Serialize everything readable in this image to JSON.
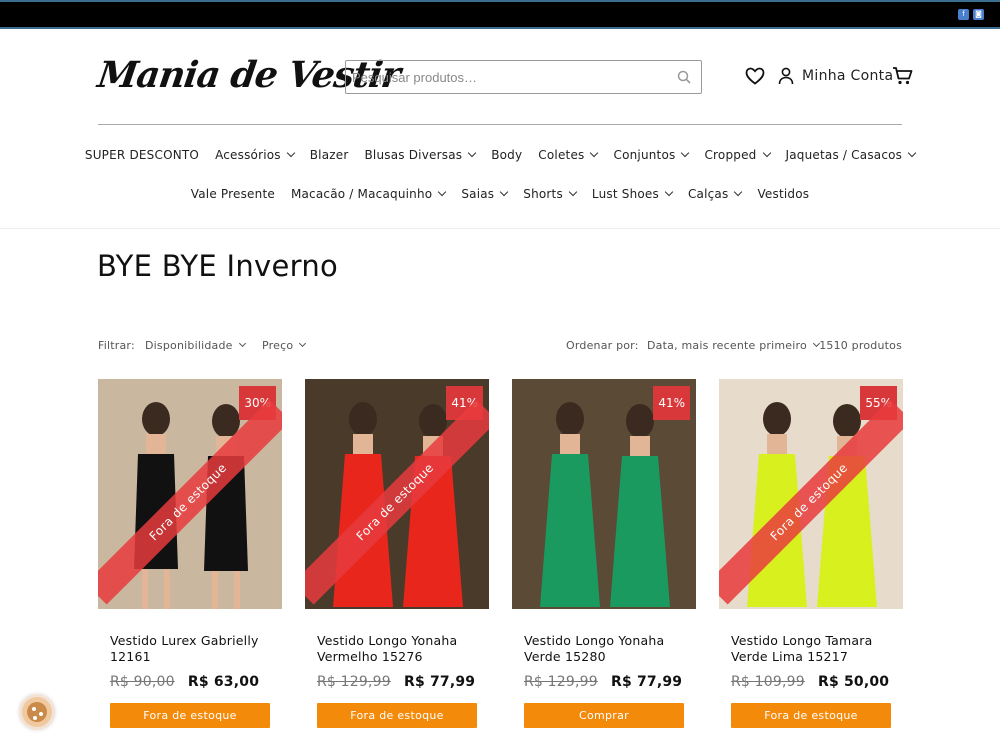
{
  "logo": "Mania de Vestir",
  "search": {
    "placeholder": "Pesquisar produtos…"
  },
  "header": {
    "account_label": "Minha Conta"
  },
  "nav_row1": [
    {
      "label": "SUPER DESCONTO",
      "dropdown": false
    },
    {
      "label": "Acessórios",
      "dropdown": true
    },
    {
      "label": "Blazer",
      "dropdown": false
    },
    {
      "label": "Blusas Diversas",
      "dropdown": true
    },
    {
      "label": "Body",
      "dropdown": false
    },
    {
      "label": "Coletes",
      "dropdown": true
    },
    {
      "label": "Conjuntos",
      "dropdown": true
    },
    {
      "label": "Cropped",
      "dropdown": true
    },
    {
      "label": "Jaquetas / Casacos",
      "dropdown": true
    }
  ],
  "nav_row2": [
    {
      "label": "Vale Presente",
      "dropdown": false
    },
    {
      "label": "Macacão / Macaquinho",
      "dropdown": true
    },
    {
      "label": "Saias",
      "dropdown": true
    },
    {
      "label": "Shorts",
      "dropdown": true
    },
    {
      "label": "Lust Shoes",
      "dropdown": true
    },
    {
      "label": "Calças",
      "dropdown": true
    },
    {
      "label": "Vestidos",
      "dropdown": false
    }
  ],
  "collection": {
    "title": "BYE BYE Inverno"
  },
  "filters": {
    "filter_label": "Filtrar:",
    "availability": "Disponibilidade",
    "price": "Preço",
    "sort_label": "Ordenar por:",
    "sort_value": "Data, mais recente primeiro",
    "count": "1510 produtos"
  },
  "products": [
    {
      "name": "Vestido Lurex Gabrielly 12161",
      "old_price": "R$ 90,00",
      "price": "R$ 63,00",
      "discount": "30%",
      "ribbon": "Fora de estoque",
      "button": "Fora de estoque",
      "color": "#111111"
    },
    {
      "name": "Vestido Longo Yonaha Vermelho 15276",
      "old_price": "R$ 129,99",
      "price": "R$ 77,99",
      "discount": "41%",
      "ribbon": "Fora de estoque",
      "button": "Fora de estoque",
      "color": "#e8261c"
    },
    {
      "name": "Vestido Longo Yonaha Verde 15280",
      "old_price": "R$ 129,99",
      "price": "R$ 77,99",
      "discount": "41%",
      "ribbon": "",
      "button": "Comprar",
      "color": "#1a9a5e"
    },
    {
      "name": "Vestido Longo Tamara Verde Lima 15217",
      "old_price": "R$ 109,99",
      "price": "R$ 50,00",
      "discount": "55%",
      "ribbon": "Fora de estoque",
      "button": "Fora de estoque",
      "color": "#d9f01f"
    }
  ],
  "colors": {
    "accent_button": "#f48a0a",
    "badge": "#d9383a"
  }
}
